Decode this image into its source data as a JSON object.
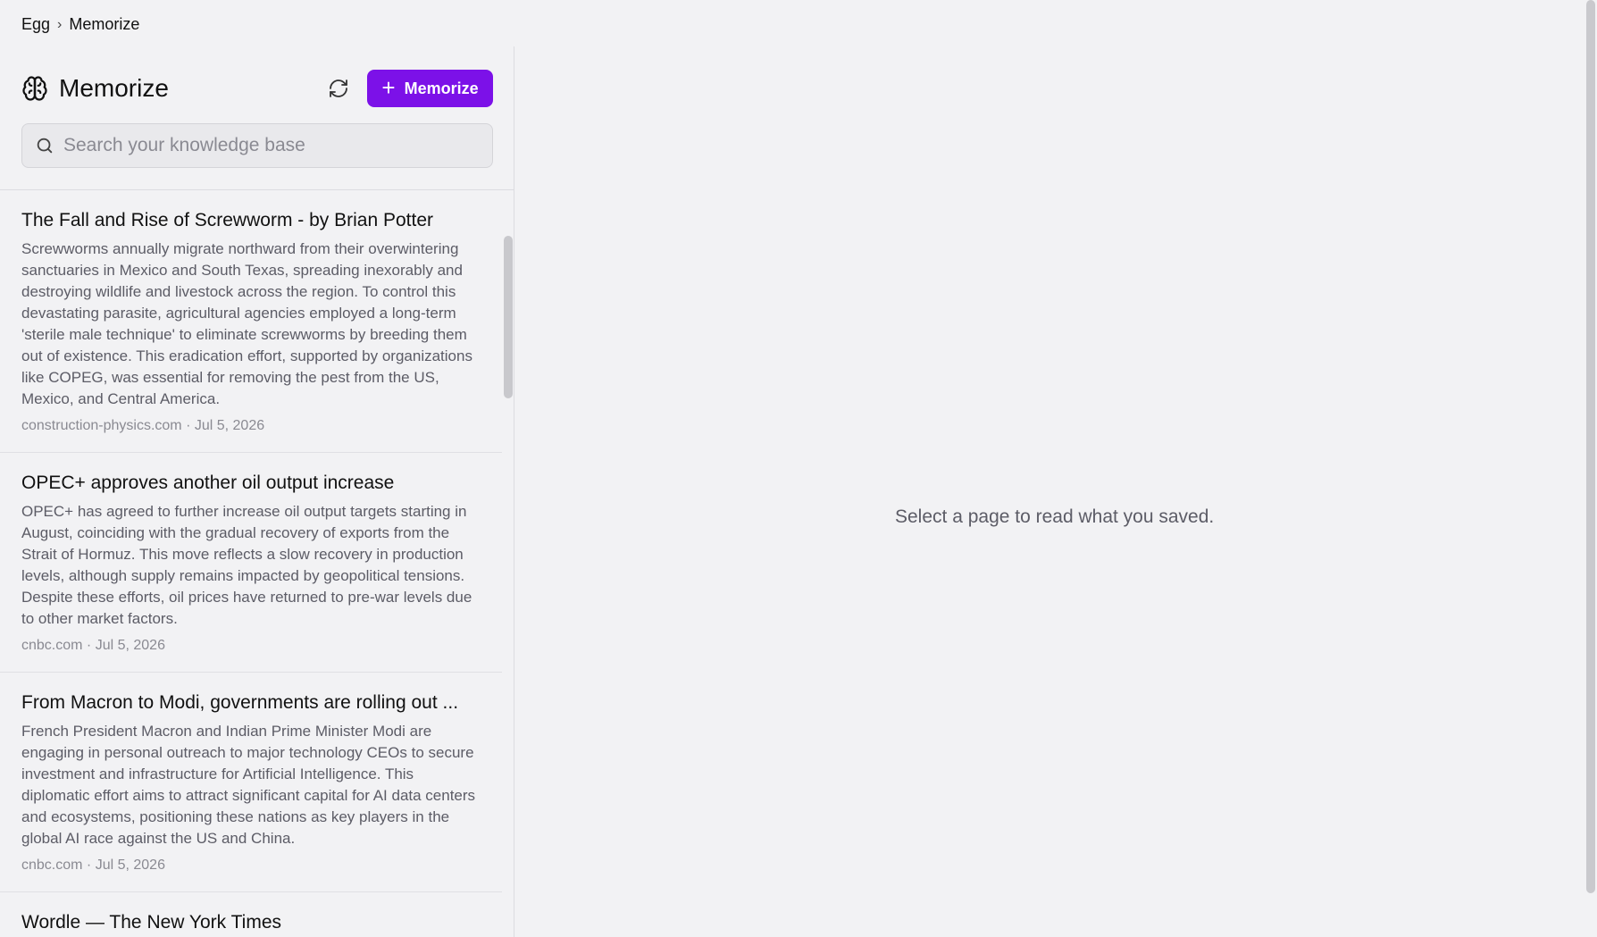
{
  "breadcrumb": {
    "root": "Egg",
    "separator": "›",
    "current": "Memorize"
  },
  "panel": {
    "icon": "brain-icon",
    "title": "Memorize",
    "refresh_icon": "refresh-icon",
    "memorize_button": {
      "icon": "plus-icon",
      "label": "Memorize"
    },
    "accent_color": "#7c11e8"
  },
  "search": {
    "icon": "search-icon",
    "placeholder": "Search your knowledge base",
    "value": ""
  },
  "items": [
    {
      "title": "The Fall and Rise of Screwworm - by Brian Potter",
      "summary": "Screwworms annually migrate northward from their overwintering sanctuaries in Mexico and South Texas, spreading inexorably and destroying wildlife and livestock across the region. To control this devastating parasite, agricultural agencies employed a long-term 'sterile male technique' to eliminate screwworms by breeding them out of existence. This eradication effort, supported by organizations like COPEG, was essential for removing the pest from the US, Mexico, and Central America.",
      "meta": "construction-physics.com · Jul 5, 2026"
    },
    {
      "title": "OPEC+ approves another oil output increase",
      "summary": "OPEC+ has agreed to further increase oil output targets starting in August, coinciding with the gradual recovery of exports from the Strait of Hormuz. This move reflects a slow recovery in production levels, although supply remains impacted by geopolitical tensions. Despite these efforts, oil prices have returned to pre-war levels due to other market factors.",
      "meta": "cnbc.com · Jul 5, 2026"
    },
    {
      "title": "From Macron to Modi, governments are rolling out ...",
      "summary": "French President Macron and Indian Prime Minister Modi are engaging in personal outreach to major technology CEOs to secure investment and infrastructure for Artificial Intelligence. This diplomatic effort aims to attract significant capital for AI data centers and ecosystems, positioning these nations as key players in the global AI race against the US and China.",
      "meta": "cnbc.com · Jul 5, 2026"
    },
    {
      "title": "Wordle — The New York Times",
      "summary": "",
      "meta": ""
    }
  ],
  "main": {
    "empty_message": "Select a page to read what you saved."
  }
}
